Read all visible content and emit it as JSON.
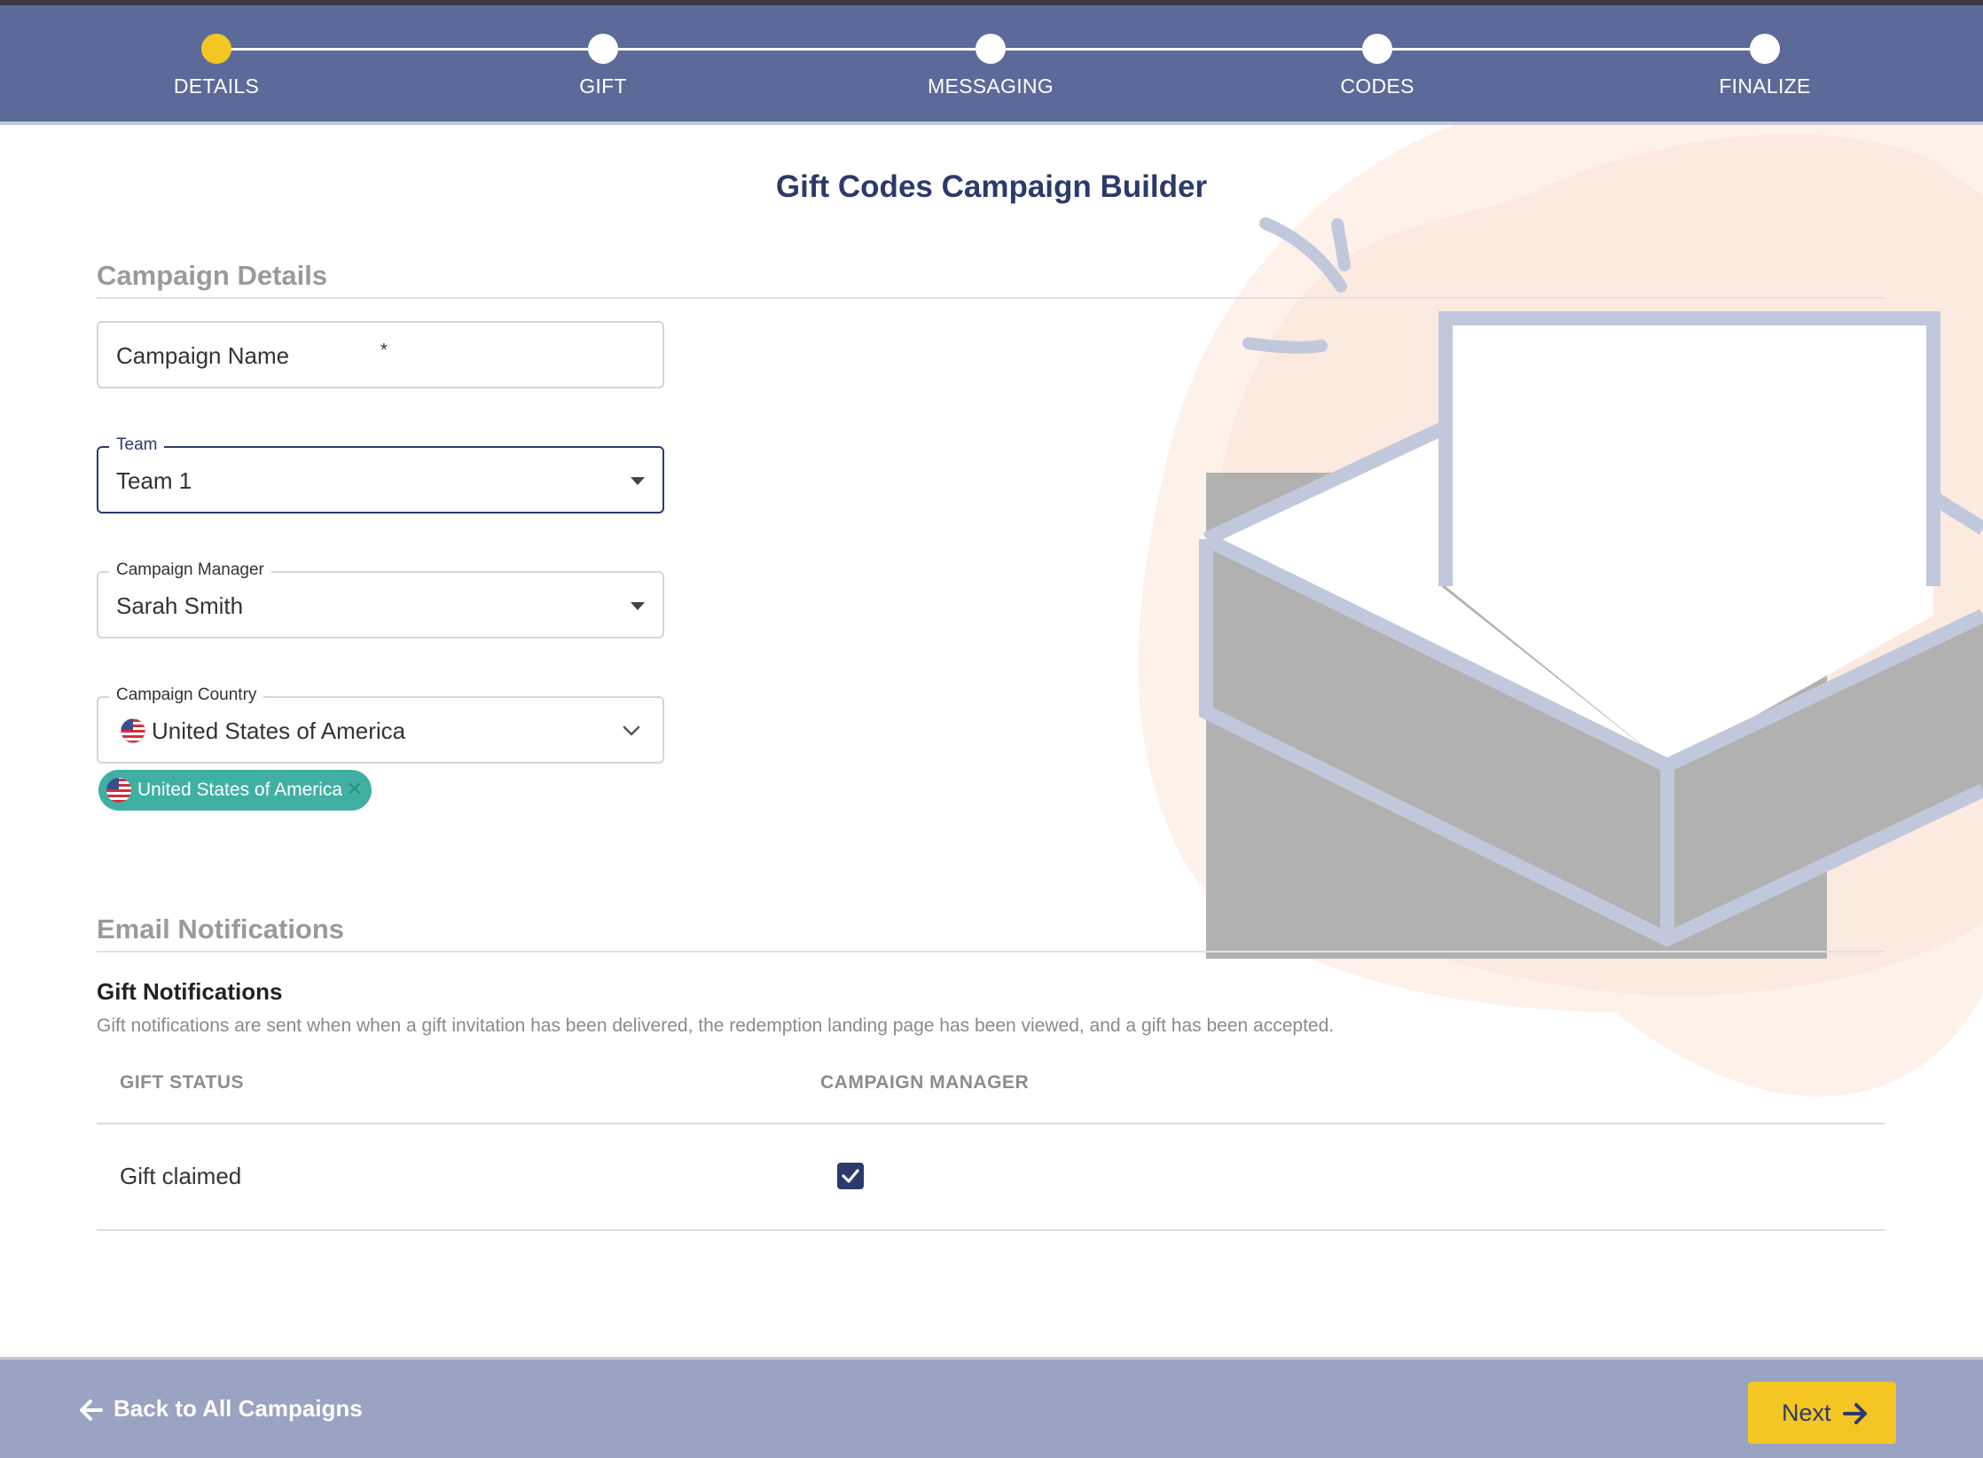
{
  "stepper": {
    "steps": [
      {
        "label": "DETAILS",
        "active": true
      },
      {
        "label": "GIFT",
        "active": false
      },
      {
        "label": "MESSAGING",
        "active": false
      },
      {
        "label": "CODES",
        "active": false
      },
      {
        "label": "FINALIZE",
        "active": false
      }
    ],
    "active_color": "#f3c623"
  },
  "page": {
    "title": "Gift Codes Campaign Builder"
  },
  "campaign_details": {
    "section_title": "Campaign Details",
    "campaign_name": {
      "placeholder": "Campaign Name",
      "required_mark": "*",
      "value": ""
    },
    "team": {
      "label": "Team",
      "value": "Team 1"
    },
    "campaign_manager": {
      "label": "Campaign Manager",
      "value": "Sarah Smith"
    },
    "campaign_country": {
      "label": "Campaign Country",
      "value": "United States of America",
      "flag_icon": "us-flag-icon"
    },
    "selected_chip": {
      "label": "United States of America",
      "remove_icon": "close-icon"
    }
  },
  "email_notifications": {
    "section_title": "Email Notifications",
    "gift_notifications": {
      "title": "Gift Notifications",
      "description": "Gift notifications are sent when when a gift invitation has been delivered, the redemption landing page has been viewed, and a gift has been accepted."
    },
    "table": {
      "headers": [
        "GIFT STATUS",
        "CAMPAIGN MANAGER"
      ],
      "rows": [
        {
          "status": "Gift claimed",
          "campaign_manager_checked": true
        }
      ]
    }
  },
  "footer": {
    "back_label": "Back to All Campaigns",
    "next_label": "Next"
  },
  "colors": {
    "header_bg": "#5b6a98",
    "title_navy": "#2c3a6b",
    "chip_teal": "#3fb0a2",
    "footer_bg": "#9aa3c2",
    "next_yellow": "#f3c623"
  }
}
